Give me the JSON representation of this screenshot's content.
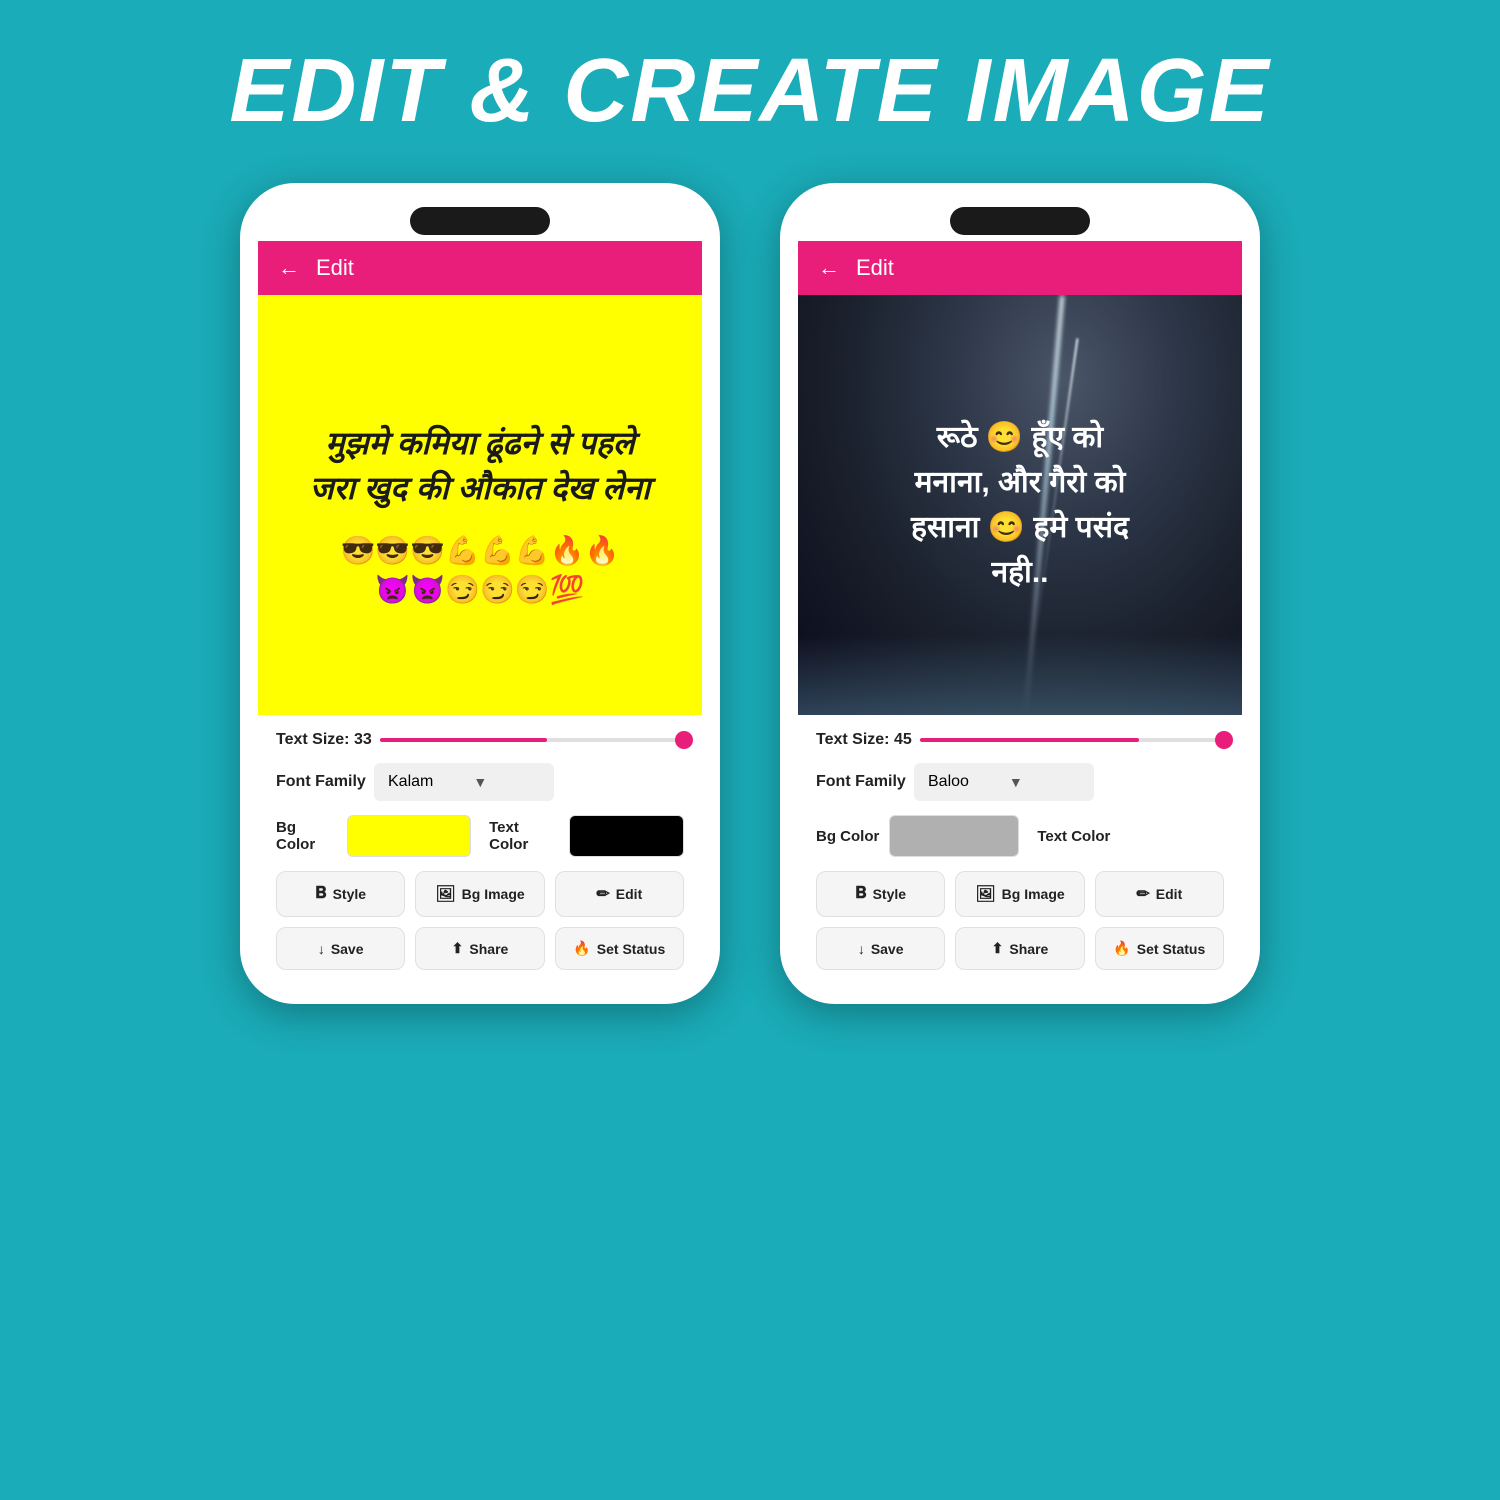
{
  "page": {
    "title": "EDIT & CREATE IMAGE",
    "bg_color": "#1aacb8"
  },
  "phone1": {
    "app_bar": {
      "back_label": "←",
      "title": "Edit"
    },
    "image": {
      "bg_color": "#ffff00",
      "text_line1": "मुझमे कमिया ढूंढने से पहले",
      "text_line2": "जरा खुद की औकात देख लेना",
      "emojis": "😎😎😎💪💪💪🔥🔥\n👿👿😏😏😏💯"
    },
    "controls": {
      "text_size_label": "Text Size:",
      "text_size_value": "33",
      "font_family_label": "Font Family",
      "font_family_value": "Kalam",
      "bg_color_label": "Bg Color",
      "text_color_label": "Text Color",
      "style_btn": "Style",
      "bg_image_btn": "Bg Image",
      "edit_btn": "Edit",
      "save_btn": "Save",
      "share_btn": "Share",
      "set_status_btn": "Set Status"
    }
  },
  "phone2": {
    "app_bar": {
      "back_label": "←",
      "title": "Edit"
    },
    "image": {
      "bg_color": "#1a1a2e",
      "text_line1": "रूठे 😊 हूँए को मनाना, और गैरो को हसाना 😊 हमे पसंद नही.."
    },
    "controls": {
      "text_size_label": "Text Size:",
      "text_size_value": "45",
      "font_family_label": "Font Family",
      "font_family_value": "Baloo",
      "bg_color_label": "Bg Color",
      "text_color_label": "Text Color",
      "style_btn": "Style",
      "bg_image_btn": "Bg Image",
      "edit_btn": "Edit",
      "save_btn": "Save",
      "share_btn": "Share",
      "set_status_btn": "Set Status"
    }
  }
}
